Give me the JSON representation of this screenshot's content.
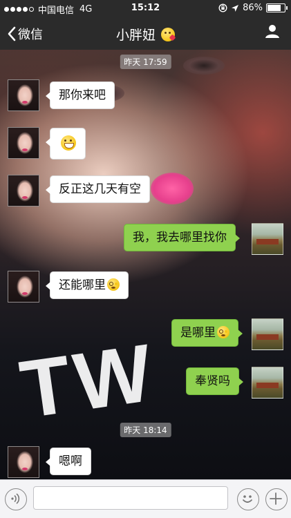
{
  "status_bar": {
    "carrier": "中国电信",
    "network": "4G",
    "time": "15:12",
    "battery": "86%",
    "battery_level": 0.86
  },
  "nav": {
    "back_label": "微信",
    "title": "小胖妞",
    "title_emoji_icon": "kissing-heart-emoji"
  },
  "timestamps": [
    "昨天 17:59",
    "昨天 18:14"
  ],
  "messages": [
    {
      "side": "left",
      "text": "那你来吧"
    },
    {
      "side": "left",
      "text": "",
      "emoji": "grinning-emoji"
    },
    {
      "side": "left",
      "text": "反正这几天有空"
    },
    {
      "side": "right",
      "text": "我，我去哪里找你"
    },
    {
      "side": "left",
      "text": "还能哪里",
      "emoji": "dizzy-face-emoji"
    },
    {
      "side": "right",
      "text": "是哪里",
      "emoji": "dizzy-face-emoji"
    },
    {
      "side": "right",
      "text": "奉贤吗"
    },
    {
      "side": "left",
      "text": "嗯啊"
    }
  ],
  "background_text": "TW",
  "input_bar": {
    "voice_icon": "voice-icon",
    "input_placeholder": "",
    "emoji_icon": "smiley-icon",
    "plus_icon": "plus-icon"
  },
  "colors": {
    "bar_bg": "#2b2b2b",
    "bubble_right": "#8fd14f",
    "bubble_left": "#ffffff"
  }
}
